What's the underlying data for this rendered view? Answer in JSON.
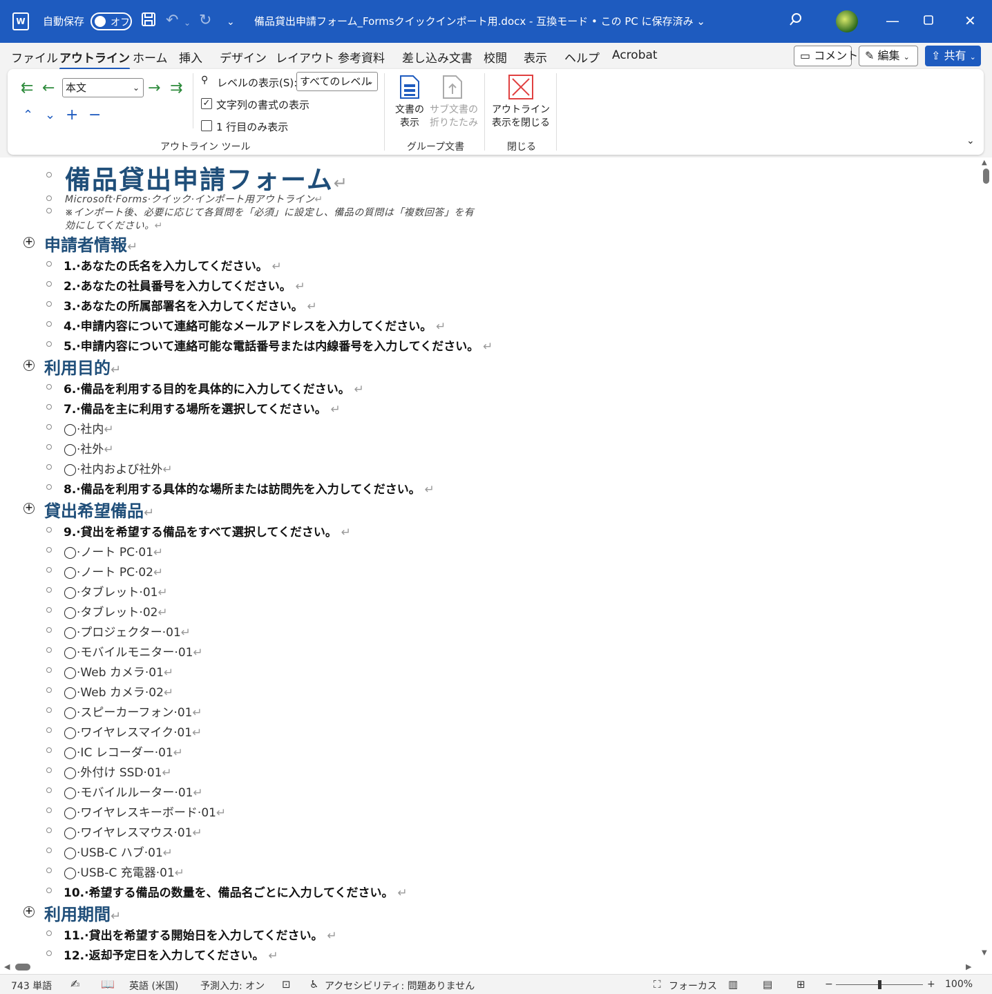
{
  "titlebar": {
    "app_icon": "word-icon",
    "autosave_label": "自動保存",
    "autosave_state": "オフ",
    "document_title": "備品貸出申請フォーム_Formsクイックインポート用.docx  -  互換モード • この PC に保存済み ⌄",
    "save_icon": "save-icon",
    "undo_icon": "undo-icon",
    "redo_icon": "redo-icon",
    "customize_icon": "customize-qat-icon"
  },
  "tabs": [
    "ファイル",
    "アウトライン",
    "ホーム",
    "挿入",
    "デザイン",
    "レイアウト",
    "参考資料",
    "差し込み文書",
    "校閲",
    "表示",
    "ヘルプ",
    "Acrobat"
  ],
  "active_tab": "アウトライン",
  "ribbon_right": {
    "comment": "コメント",
    "edit": "編集",
    "share": "共有"
  },
  "ribbon": {
    "level_select": "本文",
    "show_level_label": "レベルの表示(S):",
    "show_level_value": "すべてのレベル",
    "show_text_formatting": "文字列の書式の表示",
    "show_first_line_only": "1 行目のみ表示",
    "outline_tools_label": "アウトライン ツール",
    "show_document": "文書の\n表示",
    "show_document_l1": "文書の",
    "show_document_l2": "表示",
    "collapse_sub_l1": "サブ文書の",
    "collapse_sub_l2": "折りたたみ",
    "master_doc_label": "グループ文書",
    "close_outline_l1": "アウトライン",
    "close_outline_l2": "表示を閉じる",
    "close_label": "閉じる",
    "accent_color": "#1e5bbf"
  },
  "document": {
    "title": "備品貸出申請フォーム",
    "subtitle1": "Microsoft·Forms·クイック·インポート用アウトライン",
    "subtitle2a": "※インポート後、必要に応じて各質問を「必須」に設定し、備品の質問は「複数回答」を有",
    "subtitle2b": "効にしてください。",
    "h1": "申請者情報",
    "q1": "1.·あなたの氏名を入力してください。",
    "q2": "2.·あなたの社員番号を入力してください。",
    "q3": "3.·あなたの所属部署名を入力してください。",
    "q4": "4.·申請内容について連絡可能なメールアドレスを入力してください。",
    "q5": "5.·申請内容について連絡可能な電話番号または内線番号を入力してください。",
    "h2": "利用目的",
    "q6": "6.·備品を利用する目的を具体的に入力してください。",
    "q7": "7.·備品を主に利用する場所を選択してください。",
    "o7_1": "◯·社内",
    "o7_2": "◯·社外",
    "o7_3": "◯·社内および社外",
    "q8": "8.·備品を利用する具体的な場所または訪問先を入力してください。",
    "h3": "貸出希望備品",
    "q9": "9.·貸出を希望する備品をすべて選択してください。",
    "o9": [
      "◯·ノート PC·01",
      "◯·ノート PC·02",
      "◯·タブレット·01",
      "◯·タブレット·02",
      "◯·プロジェクター·01",
      "◯·モバイルモニター·01",
      "◯·Web カメラ·01",
      "◯·Web カメラ·02",
      "◯·スピーカーフォン·01",
      "◯·ワイヤレスマイク·01",
      "◯·IC レコーダー·01",
      "◯·外付け SSD·01",
      "◯·モバイルルーター·01",
      "◯·ワイヤレスキーボード·01",
      "◯·ワイヤレスマウス·01",
      "◯·USB-C ハブ·01",
      "◯·USB-C 充電器·01"
    ],
    "q10": "10.·希望する備品の数量を、備品名ごとに入力してください。",
    "h4": "利用期間",
    "q11": "11.·貸出を希望する開始日を入力してください。",
    "q12": "12.·返却予定日を入力してください。",
    "paragraph_mark": "↵",
    "heading_color": "#1f4e79"
  },
  "status": {
    "word_count": "743 単語",
    "language": "英語 (米国)",
    "prediction": "予測入力: オン",
    "accessibility": "アクセシビリティ: 問題ありません",
    "focus": "フォーカス",
    "zoom": "100%"
  }
}
